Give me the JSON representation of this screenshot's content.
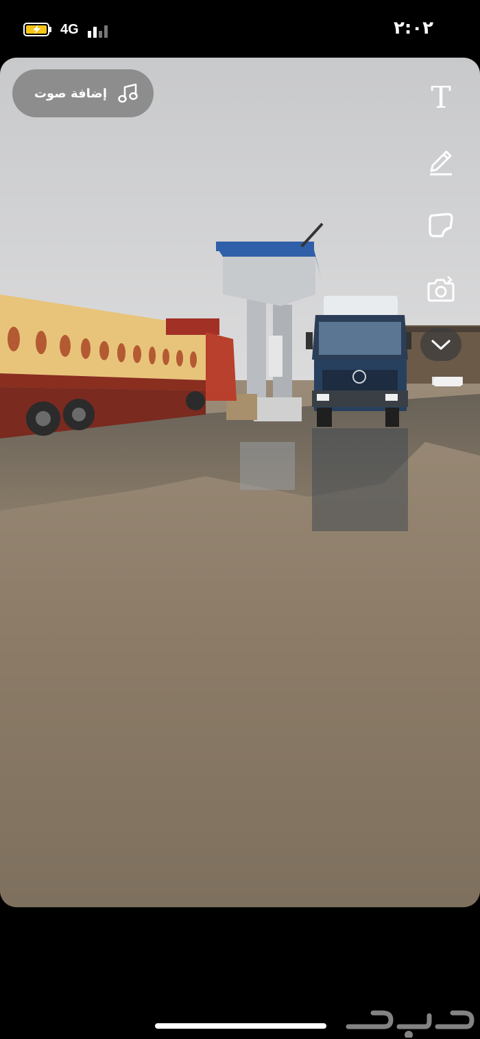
{
  "status_bar": {
    "network": "4G",
    "time": "٢:٠٢"
  },
  "sound_button": {
    "label": "إضافة صوت",
    "icon": "music-note-icon"
  },
  "toolbar": {
    "text_tool": "T",
    "icons": [
      "text-icon",
      "pencil-icon",
      "sticker-icon",
      "camera-timer-icon",
      "chevron-down-icon"
    ]
  },
  "colors": {
    "sky": "#d3d4d5",
    "ground": "#8a7a66",
    "trailer": "#e8c47a",
    "truck_blue": "#27405e"
  },
  "watermark": {
    "brand": "حراج"
  }
}
